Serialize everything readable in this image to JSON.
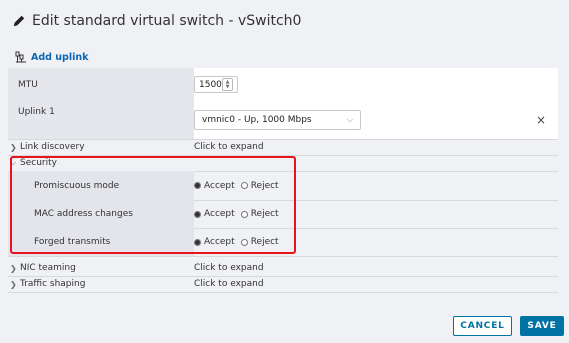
{
  "dialog": {
    "title": "Edit standard virtual switch - vSwitch0",
    "add_uplink_label": "Add uplink"
  },
  "rows": {
    "mtu": {
      "label": "MTU",
      "value": "1500"
    },
    "uplink1": {
      "label": "Uplink 1",
      "selected": "vmnic0 - Up, 1000 Mbps",
      "remove_icon": "×"
    },
    "link_discovery": {
      "label": "Link discovery",
      "value": "Click to expand"
    },
    "security": {
      "label": "Security",
      "promiscuous": {
        "label": "Promiscuous mode",
        "accept": "Accept",
        "reject": "Reject",
        "selected": "Accept"
      },
      "mac_changes": {
        "label": "MAC address changes",
        "accept": "Accept",
        "reject": "Reject",
        "selected": "Accept"
      },
      "forged": {
        "label": "Forged transmits",
        "accept": "Accept",
        "reject": "Reject",
        "selected": "Accept"
      }
    },
    "nic_teaming": {
      "label": "NIC teaming",
      "value": "Click to expand"
    },
    "traffic_shaping": {
      "label": "Traffic shaping",
      "value": "Click to expand"
    }
  },
  "footer": {
    "cancel_label": "CANCEL",
    "save_label": "SAVE"
  },
  "colors": {
    "accent": "#0072a3",
    "highlight": "#e8141c",
    "link": "#0a66b4"
  },
  "icons": {
    "title": "pencil-icon",
    "add_uplink": "network-adapter-icon",
    "expand": "chevron-right-icon",
    "collapse": "chevron-down-icon",
    "remove": "close-icon"
  }
}
